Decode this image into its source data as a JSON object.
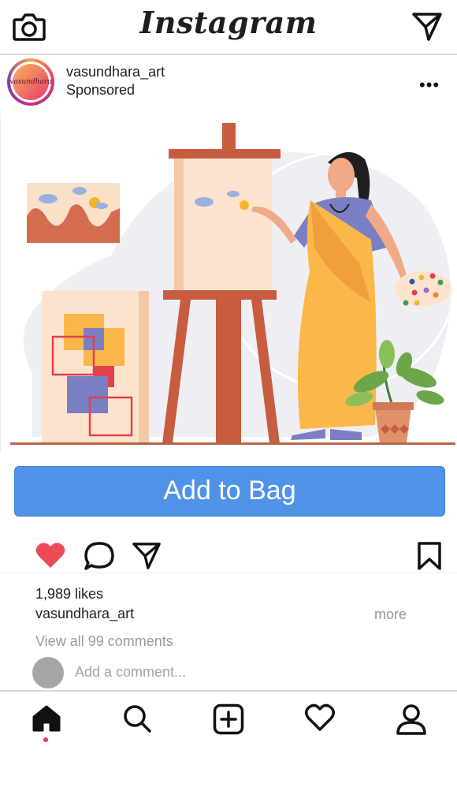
{
  "header": {
    "logo_text": "Instagram",
    "left_icon": "camera-icon",
    "right_icon": "send-icon"
  },
  "post": {
    "username": "vasundhara_art",
    "subtitle": "Sponsored",
    "avatar_text": "vasundhara",
    "menu_icon": "more-options-icon",
    "menu_label": "•••",
    "image_description_icon": "artist-painting-illustration"
  },
  "cta": {
    "label": "Add to Bag",
    "color": "#5092e8"
  },
  "actions": {
    "like_icon": "heart-filled-icon",
    "comment_icon": "comment-icon",
    "share_icon": "send-icon",
    "save_icon": "bookmark-icon",
    "like_color": "#ed4956"
  },
  "meta": {
    "likes": "1,989 likes",
    "caption_user": "vasundhara_art",
    "more_label": "more",
    "view_comments": "View all 99 comments",
    "add_comment_placeholder": "Add a comment..."
  },
  "bottom_nav": {
    "items": [
      {
        "name": "home",
        "icon": "home-icon",
        "active": true
      },
      {
        "name": "search",
        "icon": "search-icon"
      },
      {
        "name": "create",
        "icon": "add-post-icon"
      },
      {
        "name": "activity",
        "icon": "heart-icon"
      },
      {
        "name": "profile",
        "icon": "profile-icon"
      }
    ],
    "active_indicator_color": "#e8334a"
  }
}
